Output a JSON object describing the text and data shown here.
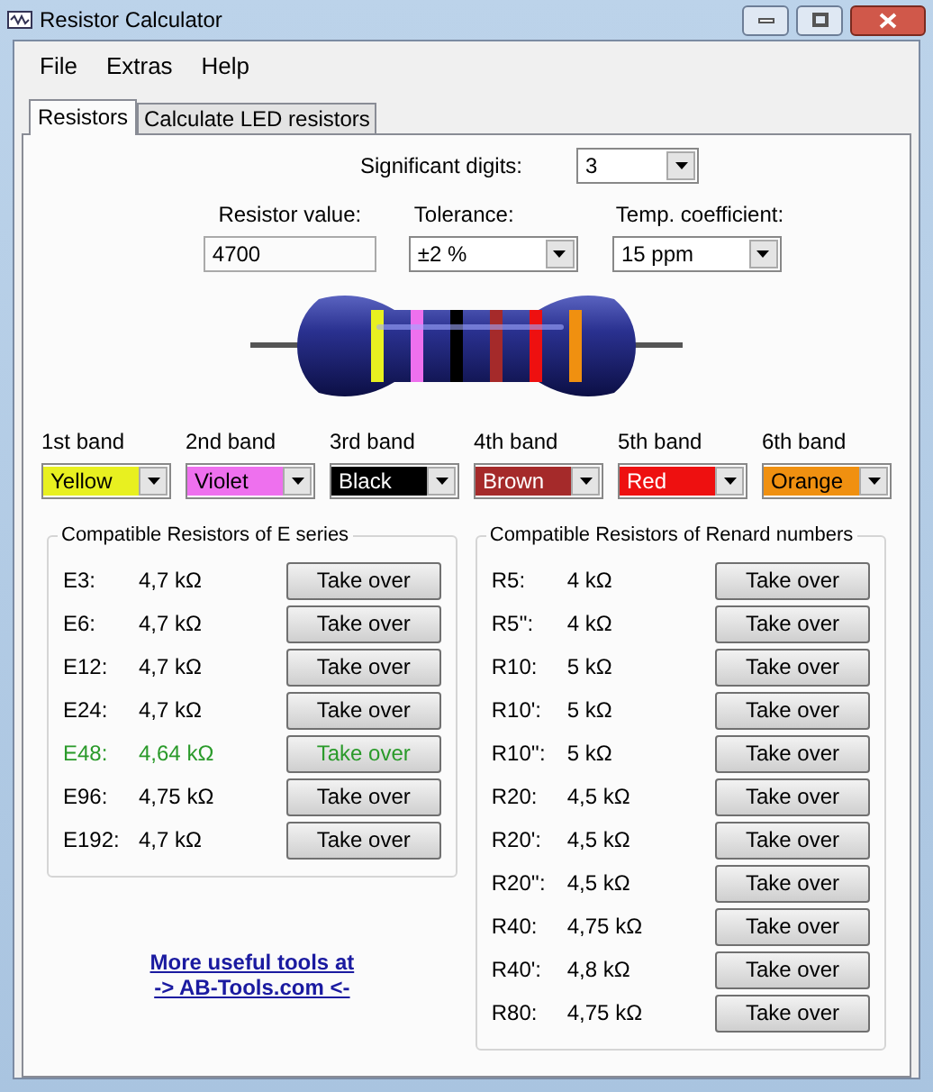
{
  "window": {
    "title": "Resistor Calculator"
  },
  "menu": [
    "File",
    "Extras",
    "Help"
  ],
  "tabs": [
    {
      "label": "Resistors",
      "selected": true
    },
    {
      "label": "Calculate LED resistors",
      "selected": false
    }
  ],
  "significant_digits": {
    "label": "Significant digits:",
    "value": "3"
  },
  "resistor_value": {
    "label": "Resistor value:",
    "value": "4700"
  },
  "tolerance": {
    "label": "Tolerance:",
    "value": "±2 %"
  },
  "temp_coefficient": {
    "label": "Temp. coefficient:",
    "value": "15 ppm"
  },
  "bands": [
    {
      "label": "1st band",
      "value": "Yellow",
      "color": "#e8f020"
    },
    {
      "label": "2nd band",
      "value": "Violet",
      "color": "#ee70ee"
    },
    {
      "label": "3rd band",
      "value": "Black",
      "color": "#000000"
    },
    {
      "label": "4th band",
      "value": "Brown",
      "color": "#a52a2a"
    },
    {
      "label": "5th band",
      "value": "Red",
      "color": "#ee1010"
    },
    {
      "label": "6th band",
      "value": "Orange",
      "color": "#f09010"
    }
  ],
  "e_series": {
    "title": "Compatible Resistors of E series",
    "rows": [
      {
        "name": "E3:",
        "value": "4,7 kΩ",
        "button": "Take over",
        "matched": false
      },
      {
        "name": "E6:",
        "value": "4,7 kΩ",
        "button": "Take over",
        "matched": false
      },
      {
        "name": "E12:",
        "value": "4,7 kΩ",
        "button": "Take over",
        "matched": false
      },
      {
        "name": "E24:",
        "value": "4,7 kΩ",
        "button": "Take over",
        "matched": false
      },
      {
        "name": "E48:",
        "value": "4,64 kΩ",
        "button": "Take over",
        "matched": true
      },
      {
        "name": "E96:",
        "value": "4,75 kΩ",
        "button": "Take over",
        "matched": false
      },
      {
        "name": "E192:",
        "value": "4,7 kΩ",
        "button": "Take over",
        "matched": false
      }
    ]
  },
  "renard": {
    "title": "Compatible Resistors of Renard numbers",
    "rows": [
      {
        "name": "R5:",
        "value": "4 kΩ",
        "button": "Take over",
        "matched": false
      },
      {
        "name": "R5'':",
        "value": "4 kΩ",
        "button": "Take over",
        "matched": false
      },
      {
        "name": "R10:",
        "value": "5 kΩ",
        "button": "Take over",
        "matched": false
      },
      {
        "name": "R10':",
        "value": "5 kΩ",
        "button": "Take over",
        "matched": false
      },
      {
        "name": "R10'':",
        "value": "5 kΩ",
        "button": "Take over",
        "matched": false
      },
      {
        "name": "R20:",
        "value": "4,5 kΩ",
        "button": "Take over",
        "matched": false
      },
      {
        "name": "R20':",
        "value": "4,5 kΩ",
        "button": "Take over",
        "matched": false
      },
      {
        "name": "R20'':",
        "value": "4,5 kΩ",
        "button": "Take over",
        "matched": false
      },
      {
        "name": "R40:",
        "value": "4,75 kΩ",
        "button": "Take over",
        "matched": false
      },
      {
        "name": "R40':",
        "value": "4,8 kΩ",
        "button": "Take over",
        "matched": false
      },
      {
        "name": "R80:",
        "value": "4,75 kΩ",
        "button": "Take over",
        "matched": false
      }
    ]
  },
  "link": [
    "More useful tools at",
    "-> AB-Tools.com <-"
  ]
}
